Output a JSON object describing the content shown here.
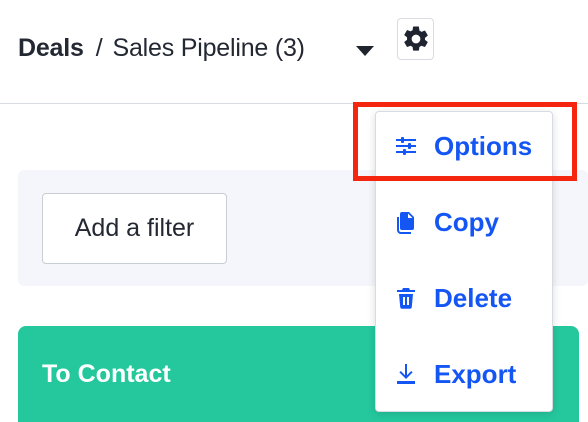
{
  "header": {
    "breadcrumb_root": "Deals",
    "breadcrumb_separator": "/",
    "pipeline_name": "Sales Pipeline (3)",
    "dropdown_icon": "chevron-down-icon",
    "settings_icon": "gear-icon"
  },
  "filters": {
    "add_filter_label": "Add a filter"
  },
  "pipeline": {
    "stage_title": "To Contact",
    "stage_color": "#25c89d"
  },
  "menu": {
    "items": [
      {
        "label": "Options",
        "icon": "sliders-icon"
      },
      {
        "label": "Copy",
        "icon": "copy-icon"
      },
      {
        "label": "Delete",
        "icon": "trash-icon"
      },
      {
        "label": "Export",
        "icon": "download-icon"
      }
    ],
    "accent_color": "#1456f3",
    "highlight_color": "#f42610"
  }
}
